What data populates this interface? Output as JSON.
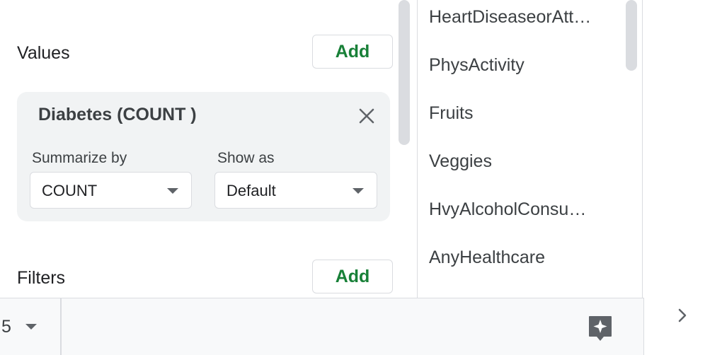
{
  "values_section": {
    "title": "Values",
    "add_label": "Add",
    "card": {
      "title": "Diabetes (COUNT )",
      "summarize_by_label": "Summarize by",
      "summarize_by_value": "COUNT",
      "show_as_label": "Show as",
      "show_as_value": "Default"
    }
  },
  "filters_section": {
    "title": "Filters",
    "add_label": "Add"
  },
  "field_list": {
    "items": [
      "HeartDiseaseorAtt…",
      "PhysActivity",
      "Fruits",
      "Veggies",
      "HvyAlcoholConsu…",
      "AnyHealthcare"
    ]
  },
  "bottom_bar": {
    "zoom_value": "5"
  },
  "icons": {
    "close": "close-icon",
    "dropdown": "chevron-down-icon",
    "explore": "sparkle-explore-icon",
    "expand": "chevron-right-icon"
  },
  "colors": {
    "add_text": "#188038",
    "card_bg": "#f1f3f4",
    "explore_icon": "#5f6368"
  }
}
